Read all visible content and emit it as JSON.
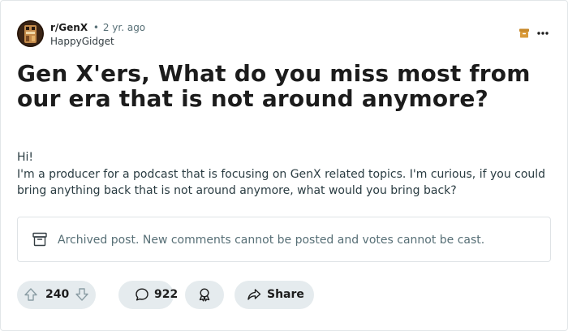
{
  "post": {
    "subreddit": "r/GenX",
    "separator": "•",
    "age": "2 yr. ago",
    "author": "HappyGidget",
    "title": "Gen X'ers, What do you miss most from our era that is not around anymore?",
    "body": {
      "greeting": "Hi!",
      "paragraph": "I'm a producer for a podcast that is focusing on GenX related topics. I'm curious, if you could bring anything back that is not around anymore, what would you bring back?"
    },
    "archived_notice": "Archived post. New comments cannot be posted and votes cannot be cast."
  },
  "header_icons": {
    "archived": "archive-box-icon",
    "more": "more-horizontal-icon"
  },
  "actions": {
    "score": "240",
    "comments": "922",
    "share_label": "Share",
    "icons": {
      "upvote": "arrow-up-icon",
      "downvote": "arrow-down-icon",
      "comment": "speech-bubble-icon",
      "award": "award-icon",
      "share": "share-arrow-icon"
    }
  },
  "colors": {
    "archive_accent": "#c8892a",
    "pill_background": "#e5ebee",
    "muted_text": "#576f76",
    "card_border": "#e2e6e8"
  }
}
